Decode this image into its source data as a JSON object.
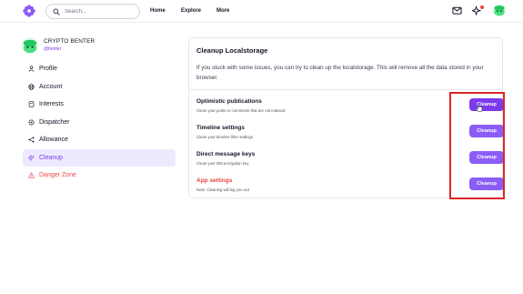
{
  "header": {
    "search_placeholder": "Search...",
    "nav": [
      {
        "label": "Home"
      },
      {
        "label": "Explore"
      },
      {
        "label": "More"
      }
    ]
  },
  "profile": {
    "name": "CRYPTO BENTER",
    "handle": "@benter"
  },
  "sidebar": {
    "items": [
      {
        "label": "Profile",
        "icon": "user-icon"
      },
      {
        "label": "Account",
        "icon": "globe-icon"
      },
      {
        "label": "Interests",
        "icon": "bookmark-icon"
      },
      {
        "label": "Dispatcher",
        "icon": "gear-icon"
      },
      {
        "label": "Allowance",
        "icon": "share-icon"
      },
      {
        "label": "Cleanup",
        "icon": "sparkle-icon",
        "active": true
      },
      {
        "label": "Danger Zone",
        "icon": "warning-icon",
        "danger": true
      }
    ]
  },
  "main": {
    "title": "Cleanup Localstorage",
    "description": "If you stuck with some issues, you can try to clean up the localstorage. This will remove all the data stored in your browser.",
    "rows": [
      {
        "title": "Optimistic publications",
        "subtitle": "Clean your posts or comments that are not indexed",
        "button": "Cleanup"
      },
      {
        "title": "Timeline settings",
        "subtitle": "Clean your timeline filter settings",
        "button": "Cleanup"
      },
      {
        "title": "Direct message keys",
        "subtitle": "Clean your DM encryption key",
        "button": "Cleanup"
      },
      {
        "title": "App settings",
        "subtitle": "Note: Cleaning will log you out",
        "button": "Cleanup",
        "danger": true
      }
    ]
  },
  "colors": {
    "accent": "#8b5cf6",
    "accent_bg": "#ede9fe",
    "danger": "#ef4444",
    "highlight_box": "#dc2626"
  }
}
